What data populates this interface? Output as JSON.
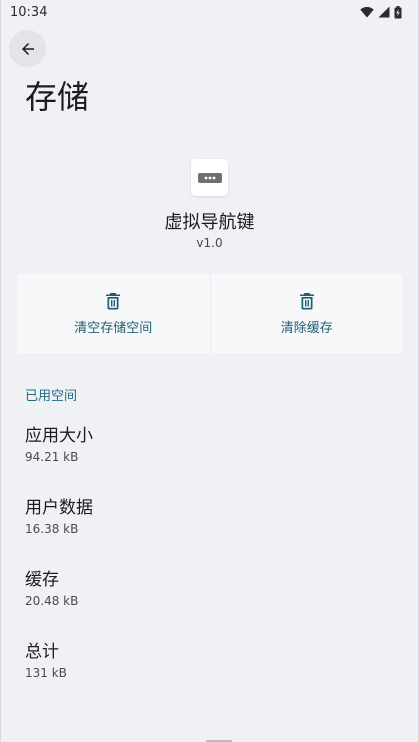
{
  "status_bar": {
    "time": "10:34"
  },
  "header": {
    "title": "存储"
  },
  "app": {
    "name": "虚拟导航键",
    "version": "v1.0"
  },
  "actions": {
    "clear_storage": "清空存储空间",
    "clear_cache": "清除缓存"
  },
  "section": {
    "title": "已用空间"
  },
  "usage": [
    {
      "label": "应用大小",
      "value": "94.21 kB"
    },
    {
      "label": "用户数据",
      "value": "16.38 kB"
    },
    {
      "label": "缓存",
      "value": "20.48 kB"
    },
    {
      "label": "总计",
      "value": "131 kB"
    }
  ],
  "colors": {
    "accent": "#1f5e72",
    "background": "#f0f1f4"
  },
  "icons": [
    "wifi-icon",
    "signal-icon",
    "battery-icon",
    "back-arrow-icon",
    "trash-icon"
  ]
}
